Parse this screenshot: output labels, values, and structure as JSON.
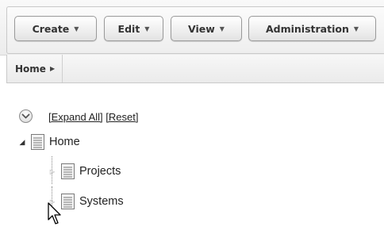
{
  "toolbar": {
    "buttons": [
      {
        "label": "Create"
      },
      {
        "label": "Edit"
      },
      {
        "label": "View"
      },
      {
        "label": "Administration"
      }
    ],
    "caret_icon": "caret-down-icon"
  },
  "breadcrumb": {
    "items": [
      {
        "label": "Home",
        "icon": "chevron-right-icon"
      }
    ]
  },
  "tree": {
    "expand_all_label": "[Expand All]",
    "reset_label": "[Reset]",
    "nodes": [
      {
        "label": "Home",
        "expanded": true,
        "icon": "document-icon"
      },
      {
        "label": "Projects",
        "expanded": false,
        "icon": "document-icon"
      },
      {
        "label": "Systems",
        "expanded": false,
        "icon": "document-icon"
      }
    ]
  },
  "colors": {
    "text": "#333333",
    "border": "#9a9a9a",
    "toolbar_bg": "#eeeeee"
  }
}
